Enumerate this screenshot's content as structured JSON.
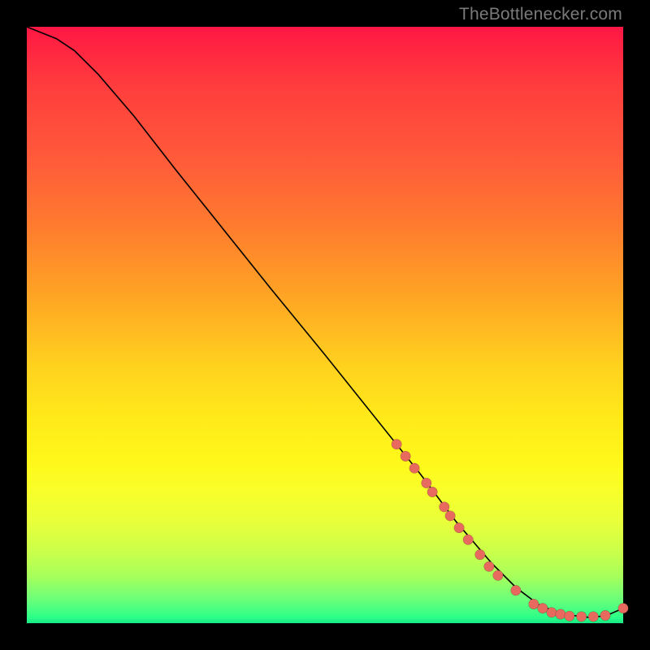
{
  "watermark": "TheBottlenecker.com",
  "colors": {
    "dot": "#e86a5e",
    "curve": "#000000",
    "gradient_top": "#ff1744",
    "gradient_bottom": "#17e884"
  },
  "chart_data": {
    "type": "line",
    "title": "",
    "xlabel": "",
    "ylabel": "",
    "xlim": [
      0,
      100
    ],
    "ylim": [
      0,
      100
    ],
    "series": [
      {
        "name": "bottleneck-curve",
        "x": [
          0,
          5,
          8,
          12,
          18,
          25,
          33,
          41,
          50,
          58,
          66,
          72,
          78,
          82,
          86,
          90,
          94,
          97,
          100
        ],
        "y": [
          100,
          98,
          96,
          92,
          85,
          76,
          66,
          56,
          45,
          35,
          25,
          17,
          10,
          6,
          3,
          1.5,
          1,
          1.2,
          2.5
        ]
      }
    ],
    "scatter": [
      {
        "name": "highlighted-points",
        "points": [
          {
            "x": 62,
            "y": 30
          },
          {
            "x": 63.5,
            "y": 28
          },
          {
            "x": 65,
            "y": 26
          },
          {
            "x": 67,
            "y": 23.5
          },
          {
            "x": 68,
            "y": 22
          },
          {
            "x": 70,
            "y": 19.5
          },
          {
            "x": 71,
            "y": 18
          },
          {
            "x": 72.5,
            "y": 16
          },
          {
            "x": 74,
            "y": 14
          },
          {
            "x": 76,
            "y": 11.5
          },
          {
            "x": 77.5,
            "y": 9.5
          },
          {
            "x": 79,
            "y": 8
          },
          {
            "x": 82,
            "y": 5.5
          },
          {
            "x": 85,
            "y": 3.2
          },
          {
            "x": 86.5,
            "y": 2.5
          },
          {
            "x": 88,
            "y": 1.8
          },
          {
            "x": 89.5,
            "y": 1.5
          },
          {
            "x": 91,
            "y": 1.2
          },
          {
            "x": 93,
            "y": 1.1
          },
          {
            "x": 95,
            "y": 1.1
          },
          {
            "x": 97,
            "y": 1.3
          },
          {
            "x": 100,
            "y": 2.5
          }
        ]
      }
    ]
  }
}
